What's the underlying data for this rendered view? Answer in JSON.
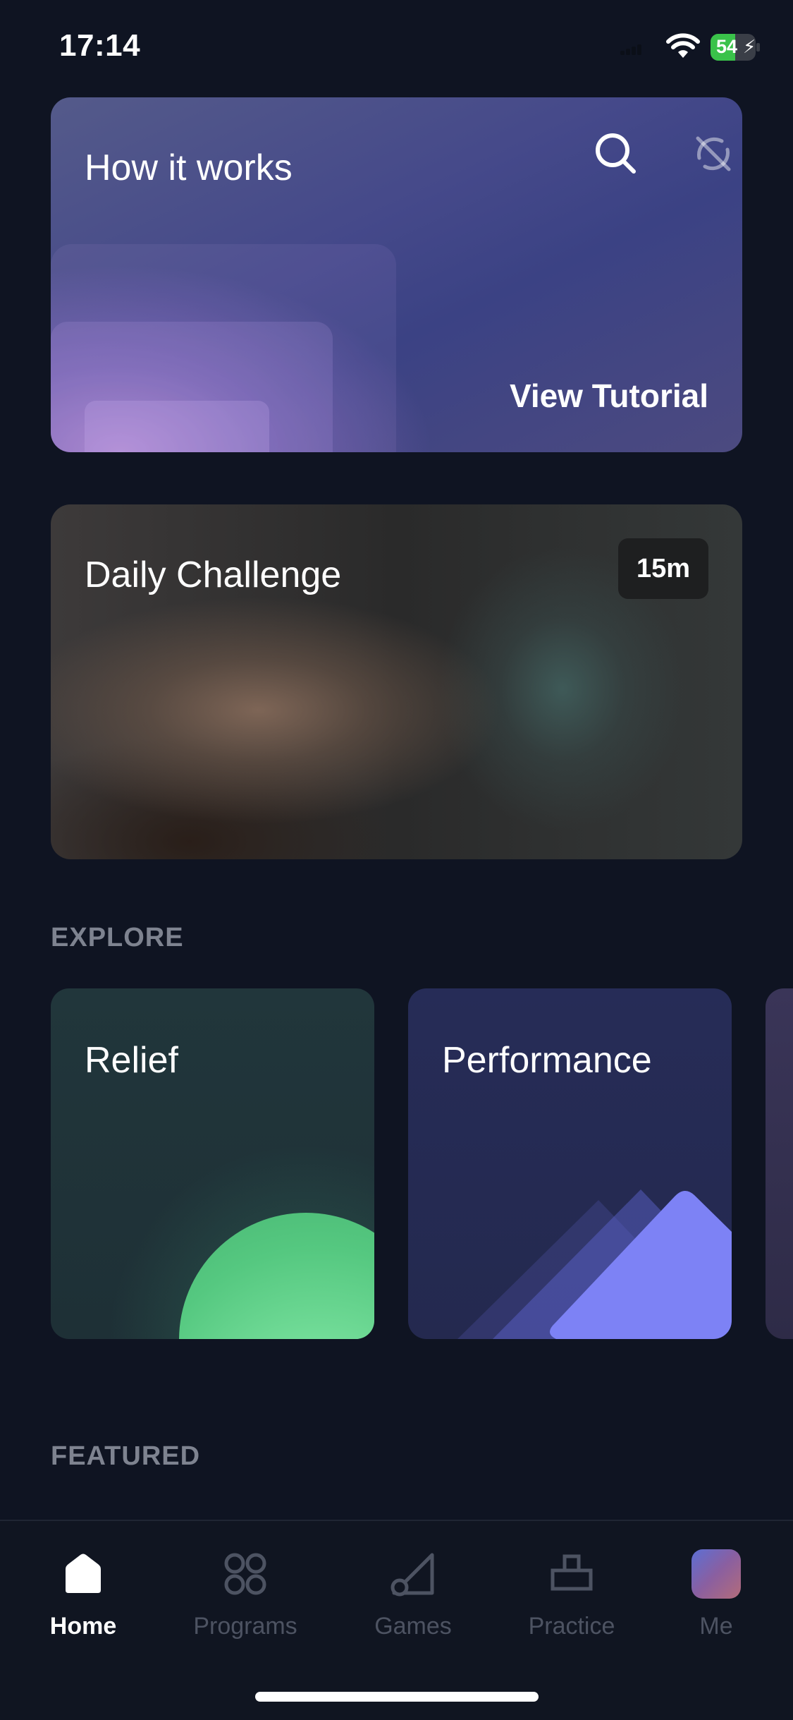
{
  "status_bar": {
    "time": "17:14",
    "battery": "54"
  },
  "how_it_works": {
    "title": "How it works",
    "cta": "View Tutorial"
  },
  "daily_challenge": {
    "title": "Daily Challenge",
    "duration": "15m"
  },
  "explore": {
    "label": "EXPLORE",
    "cards": [
      {
        "title": "Relief"
      },
      {
        "title": "Performance"
      }
    ]
  },
  "featured": {
    "label": "FEATURED"
  },
  "tabbar": {
    "tabs": [
      {
        "label": "Home",
        "icon": "home-icon",
        "active": true
      },
      {
        "label": "Programs",
        "icon": "programs-icon",
        "active": false
      },
      {
        "label": "Games",
        "icon": "games-icon",
        "active": false
      },
      {
        "label": "Practice",
        "icon": "practice-icon",
        "active": false
      },
      {
        "label": "Me",
        "icon": "avatar",
        "active": false
      }
    ]
  },
  "colors": {
    "background": "#0f1422",
    "relief_accent": "#72dc98",
    "performance_accent": "#7d82f5",
    "battery_fill": "#3ac24a"
  }
}
